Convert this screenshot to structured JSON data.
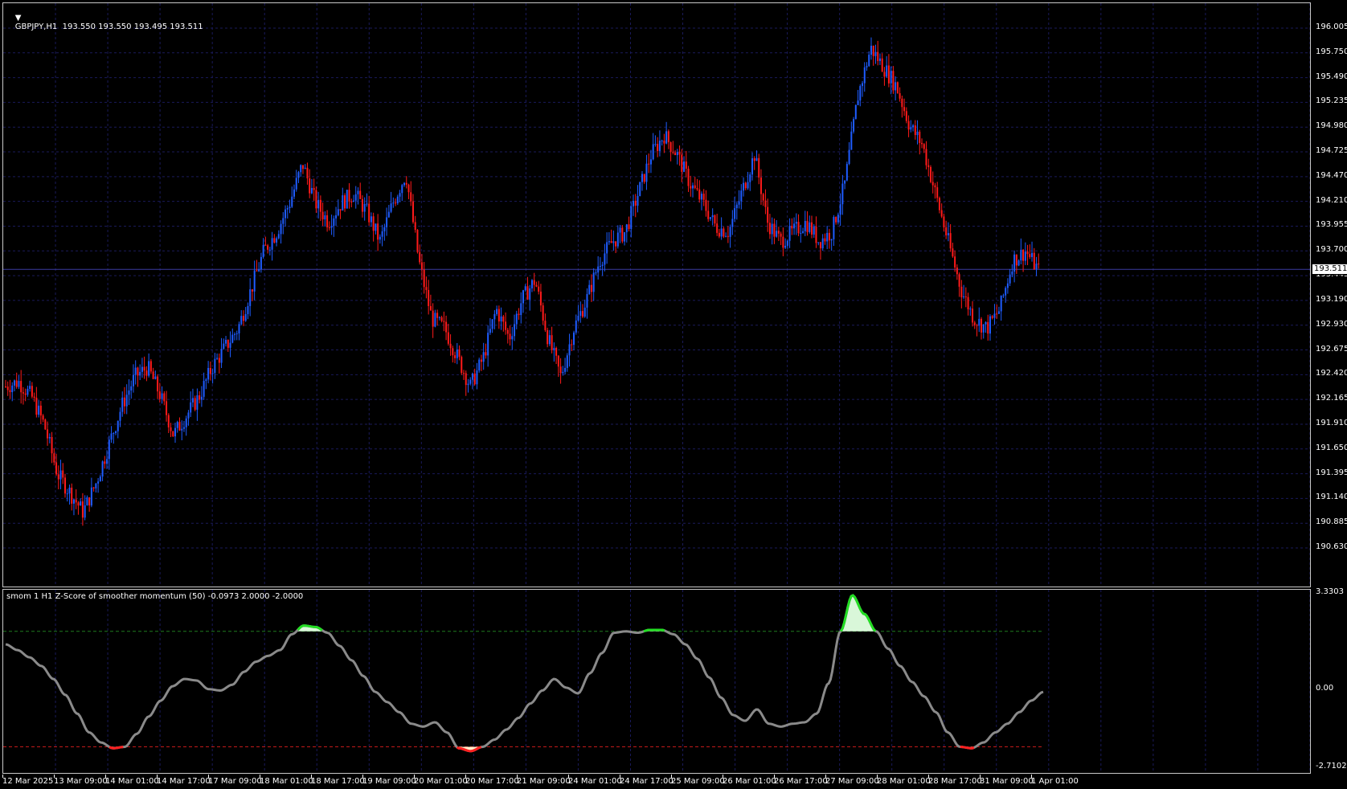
{
  "chart": {
    "symbol_header": "GBPJPY,H1  193.550 193.550 193.495 193.511",
    "current_price": "193.511",
    "colors": {
      "bull": "#1e5cff",
      "bear": "#ff1a1a",
      "grid": "#1a1a5a",
      "line": "#777777"
    },
    "price_axis": [
      "196.005",
      "195.750",
      "195.490",
      "195.235",
      "194.980",
      "194.725",
      "194.470",
      "194.210",
      "193.955",
      "193.700",
      "193.445",
      "193.190",
      "192.930",
      "192.675",
      "192.420",
      "192.165",
      "191.910",
      "191.650",
      "191.395",
      "191.140",
      "190.885",
      "190.630"
    ],
    "price_range": [
      190.63,
      196.005
    ]
  },
  "indicator": {
    "title": "smom 1 H1 Z-Score of smoother momentum (50) -0.0973 2.0000 -2.0000",
    "axis": [
      "3.3303",
      "0.00",
      "-2.7102"
    ],
    "upper_level": 2.0,
    "lower_level": -2.0,
    "range": [
      -2.7102,
      3.3303
    ],
    "colors": {
      "line": "#8a8a8a",
      "up": "#22dd22",
      "down": "#ff2020",
      "up_fill": "#d9f7d9",
      "down_fill": "#fff0cc",
      "upper_dash": "#1f7a1f",
      "lower_dash": "#c21a1a"
    },
    "series": [
      1.55,
      1.35,
      1.1,
      0.8,
      0.35,
      -0.2,
      -0.85,
      -1.5,
      -1.85,
      -2.05,
      -2.0,
      -1.55,
      -0.95,
      -0.4,
      0.1,
      0.35,
      0.3,
      0.0,
      -0.05,
      0.15,
      0.6,
      0.95,
      1.15,
      1.35,
      1.9,
      2.2,
      2.15,
      1.95,
      1.5,
      1.0,
      0.45,
      -0.1,
      -0.45,
      -0.8,
      -1.2,
      -1.3,
      -1.15,
      -1.5,
      -2.05,
      -2.15,
      -2.0,
      -1.75,
      -1.4,
      -1.0,
      -0.5,
      -0.05,
      0.35,
      0.05,
      -0.15,
      0.55,
      1.25,
      1.95,
      2.0,
      1.95,
      2.05,
      2.05,
      1.9,
      1.55,
      1.05,
      0.4,
      -0.3,
      -0.9,
      -1.1,
      -0.7,
      -1.2,
      -1.3,
      -1.2,
      -1.15,
      -0.85,
      0.2,
      2.0,
      3.25,
      2.6,
      2.0,
      1.4,
      0.8,
      0.25,
      -0.25,
      -0.8,
      -1.5,
      -2.0,
      -2.05,
      -1.85,
      -1.5,
      -1.2,
      -0.8,
      -0.4,
      -0.1
    ]
  },
  "time_axis": [
    "12 Mar 2025",
    "13 Mar 09:00",
    "14 Mar 01:00",
    "14 Mar 17:00",
    "17 Mar 09:00",
    "18 Mar 01:00",
    "18 Mar 17:00",
    "19 Mar 09:00",
    "20 Mar 01:00",
    "20 Mar 17:00",
    "21 Mar 09:00",
    "24 Mar 01:00",
    "24 Mar 17:00",
    "25 Mar 09:00",
    "26 Mar 01:00",
    "26 Mar 17:00",
    "27 Mar 09:00",
    "28 Mar 01:00",
    "28 Mar 17:00",
    "31 Mar 09:00",
    "1 Apr 01:00"
  ],
  "price_path": [
    192.3,
    192.35,
    192.2,
    191.9,
    191.4,
    191.2,
    191.0,
    191.3,
    191.7,
    192.1,
    192.4,
    192.5,
    192.2,
    191.8,
    192.0,
    192.2,
    192.5,
    192.7,
    192.9,
    193.3,
    193.7,
    193.9,
    194.2,
    194.6,
    194.2,
    194.0,
    194.2,
    194.3,
    194.1,
    193.8,
    194.2,
    194.5,
    193.6,
    193.0,
    192.9,
    192.6,
    192.3,
    192.6,
    193.1,
    192.8,
    193.2,
    193.4,
    192.8,
    192.4,
    192.9,
    193.2,
    193.6,
    193.8,
    193.9,
    194.3,
    194.7,
    194.9,
    194.7,
    194.4,
    194.2,
    193.95,
    193.9,
    194.3,
    194.7,
    194.0,
    193.8,
    193.9,
    194.0,
    193.8,
    193.9,
    194.4,
    195.3,
    195.8,
    195.6,
    195.4,
    195.0,
    194.8,
    194.3,
    193.8,
    193.3,
    193.0,
    192.9,
    193.1,
    193.6,
    193.7,
    193.5
  ]
}
